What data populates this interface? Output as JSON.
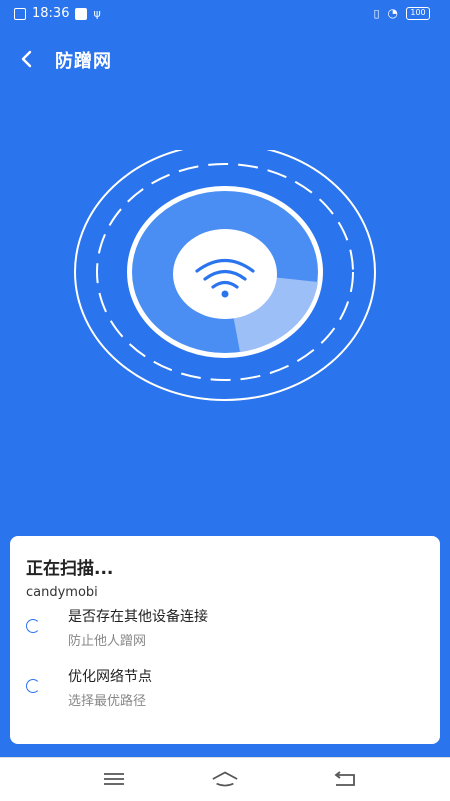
{
  "status_bar": {
    "time": "18:36",
    "battery": "100",
    "icons": [
      "sim-icon",
      "notification-icon",
      "usb-icon",
      "vibrate-icon",
      "wifi-icon",
      "battery-icon"
    ]
  },
  "header": {
    "title": "防蹭网"
  },
  "scan_card": {
    "heading": "正在扫描...",
    "network_name": "candymobi",
    "items": [
      {
        "label": "是否存在其他设备连接",
        "desc": "防止他人蹭网"
      },
      {
        "label": "优化网络节点",
        "desc": "选择最优路径"
      }
    ]
  },
  "colors": {
    "primary": "#2a74ee",
    "card": "#ffffff",
    "accent_light": "#a9c8ff"
  }
}
